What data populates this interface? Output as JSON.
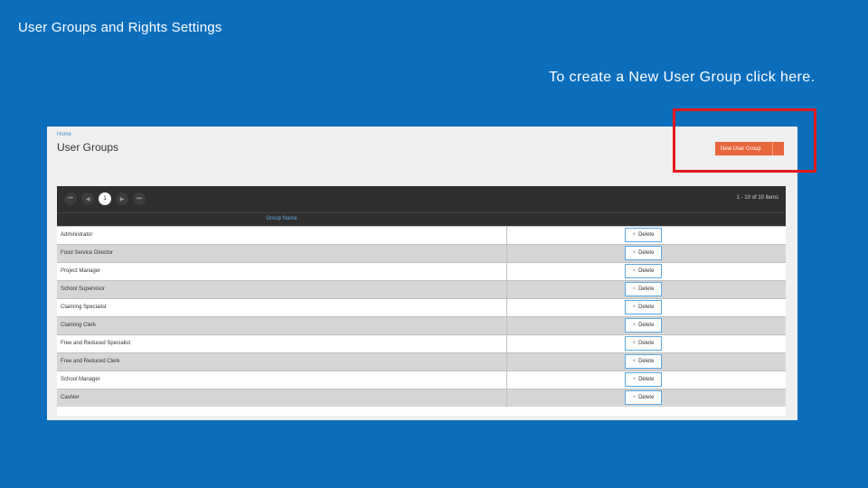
{
  "slide": {
    "title": "User Groups and Rights Settings",
    "callout": "To create a New User Group click here."
  },
  "app": {
    "breadcrumb": "Home",
    "page_title": "User Groups",
    "new_button_label": "New User Group",
    "pager": {
      "first": "⏮",
      "prev": "◀",
      "current_page": "1",
      "next": "▶",
      "last": "⏭",
      "info": "1 - 10 of 10 items"
    },
    "grid": {
      "column_header": "Group Name",
      "delete_label": "Delete",
      "delete_icon": "×",
      "rows": [
        "Administrator",
        "Food Service Director",
        "Project Manager",
        "School Supervisor",
        "Claiming Specialist",
        "Claiming Clerk",
        "Free and Reduced Specialist",
        "Free and Reduced Clerk",
        "School Manager",
        "Cashier"
      ]
    }
  },
  "colors": {
    "slide_background": "#0b6ebd",
    "accent_button": "#e8663c",
    "highlight_box": "#e3181d",
    "link": "#3a8fd1"
  }
}
